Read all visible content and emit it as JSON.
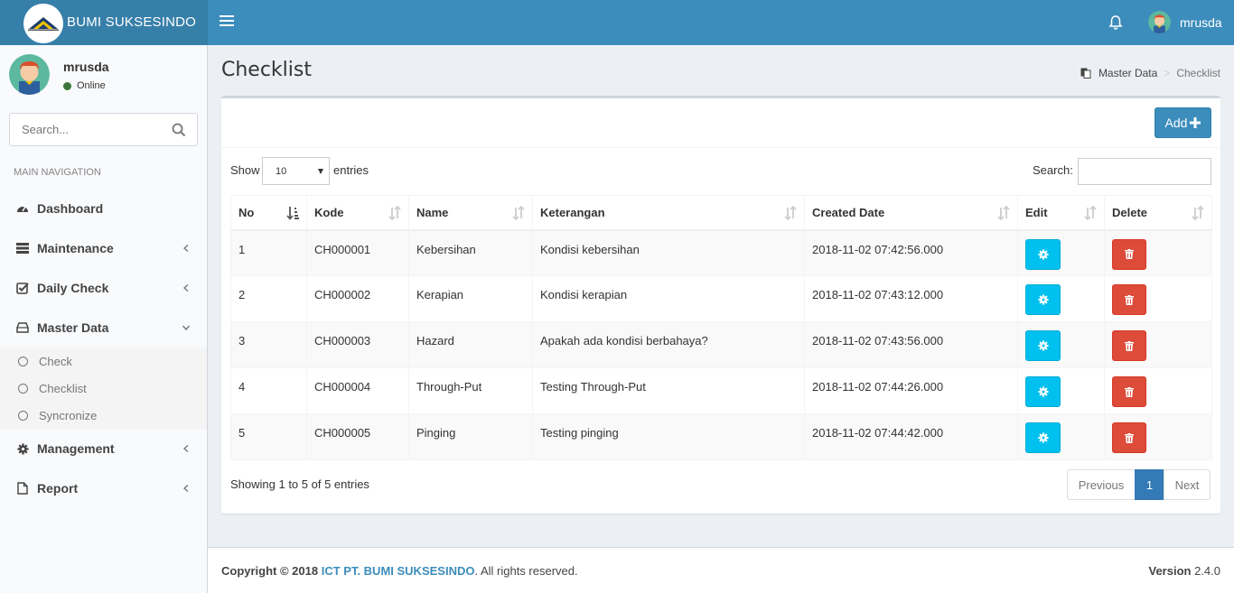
{
  "header": {
    "brand": "BUMI SUKSESINDO",
    "user_name": "mrusda"
  },
  "sidebar": {
    "user_name": "mrusda",
    "status": "Online",
    "search_placeholder": "Search...",
    "nav_header": "MAIN NAVIGATION",
    "items": [
      {
        "label": "Dashboard",
        "icon": "dashboard-icon"
      },
      {
        "label": "Maintenance",
        "icon": "list-icon"
      },
      {
        "label": "Daily Check",
        "icon": "check-square-icon"
      },
      {
        "label": "Master Data",
        "icon": "hdd-icon"
      },
      {
        "label": "Management",
        "icon": "gear-icon"
      },
      {
        "label": "Report",
        "icon": "file-icon"
      }
    ],
    "subitems": [
      "Check",
      "Checklist",
      "Syncronize"
    ]
  },
  "page": {
    "title": "Checklist",
    "breadcrumb": [
      "Master Data",
      "Checklist"
    ]
  },
  "toolbar": {
    "add_label": "Add"
  },
  "datatable": {
    "show_label": "Show",
    "page_length": "10",
    "entries_label": "entries",
    "search_label": "Search:",
    "columns": [
      "No",
      "Kode",
      "Name",
      "Keterangan",
      "Created Date",
      "Edit",
      "Delete"
    ],
    "rows": [
      {
        "no": "1",
        "kode": "CH000001",
        "name": "Kebersihan",
        "keterangan": "Kondisi kebersihan",
        "created": "2018-11-02 07:42:56.000"
      },
      {
        "no": "2",
        "kode": "CH000002",
        "name": "Kerapian",
        "keterangan": "Kondisi kerapian",
        "created": "2018-11-02 07:43:12.000"
      },
      {
        "no": "3",
        "kode": "CH000003",
        "name": "Hazard",
        "keterangan": "Apakah ada kondisi berbahaya?",
        "created": "2018-11-02 07:43:56.000"
      },
      {
        "no": "4",
        "kode": "CH000004",
        "name": "Through-Put",
        "keterangan": "Testing Through-Put",
        "created": "2018-11-02 07:44:26.000"
      },
      {
        "no": "5",
        "kode": "CH000005",
        "name": "Pinging",
        "keterangan": "Testing pinging",
        "created": "2018-11-02 07:44:42.000"
      }
    ],
    "info": "Showing 1 to 5 of 5 entries",
    "pagination": {
      "previous": "Previous",
      "current": "1",
      "next": "Next"
    }
  },
  "footer": {
    "copyright_prefix": "Copyright © 2018 ",
    "company": "ICT PT. BUMI SUKSESINDO",
    "rights": ". All rights reserved.",
    "version_label": "Version",
    "version": "2.4.0"
  },
  "colors": {
    "header": "#3c8dbc",
    "logo_bg": "#367fa9",
    "edit_button": "#00c0ef",
    "delete_button": "#dd4b39",
    "primary": "#337ab7"
  }
}
